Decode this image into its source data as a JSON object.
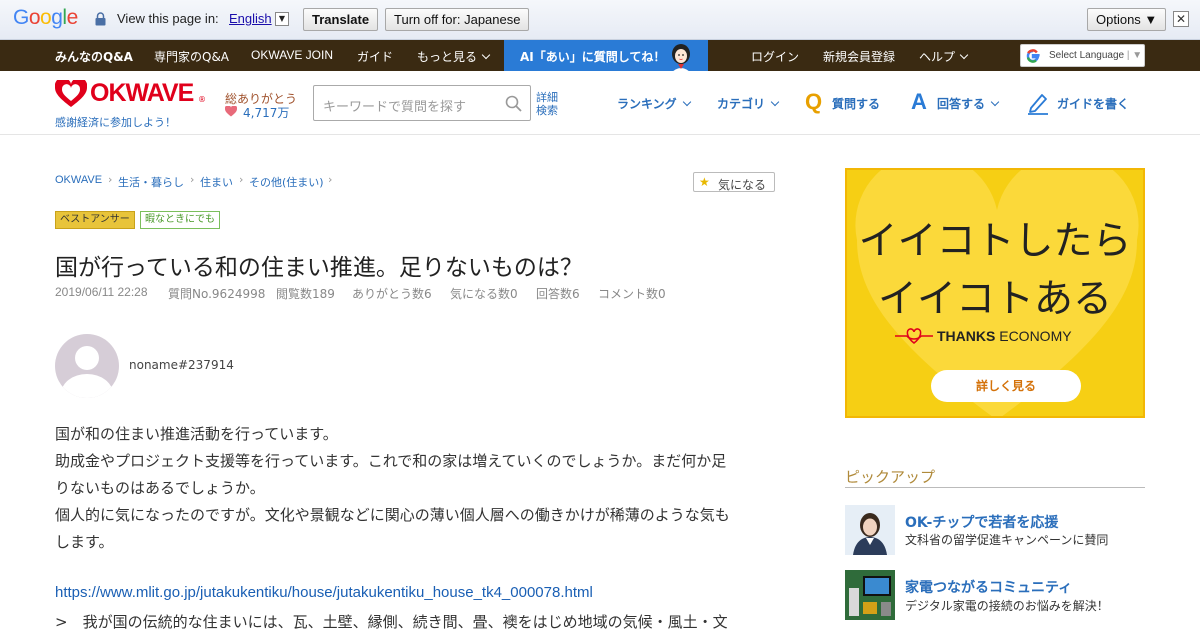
{
  "translate_bar": {
    "logo": "Google",
    "view_text": "View this page in:",
    "language": "English",
    "translate_label": "Translate",
    "turn_off_label": "Turn off for: Japanese",
    "options_label": "Options ▼",
    "close_glyph": "✕"
  },
  "top_nav": {
    "items": [
      "みんなのQ&A",
      "専門家のQ&A",
      "OKWAVE JOIN",
      "ガイド",
      "もっと見る"
    ],
    "ai_banner": "AI「あい」に質問してね！",
    "right_items": [
      "ログイン",
      "新規会員登録",
      "ヘルプ"
    ],
    "select_language": "Select Language"
  },
  "header": {
    "logo": "OKWAVE",
    "logo_mark": "®",
    "tagline": "感謝経済に参加しよう！",
    "thanks_label": "総ありがとう",
    "thanks_count": "4,717万",
    "search_placeholder": "キーワードで質問を探す",
    "advanced_search_line1": "詳細",
    "advanced_search_line2": "検索",
    "nav": [
      "ランキング",
      "カテゴリ",
      "質問する",
      "回答する",
      "ガイドを書く"
    ],
    "ask_glyph": "Q",
    "answer_glyph": "A"
  },
  "breadcrumb": [
    "OKWAVE",
    "生活・暮らし",
    "住まい",
    "その他(住まい)"
  ],
  "favorite_label": "気になる",
  "tags": [
    "ベストアンサー",
    "暇なときにでも"
  ],
  "question": {
    "title": "国が行っている和の住まい推進。足りないものは？",
    "meta": [
      "2019/06/11 22:28",
      "質問No.9624998",
      "閲覧数189",
      "ありがとう数6",
      "気になる数0",
      "回答数6",
      "コメント数0"
    ],
    "author": "noname#237914",
    "body": [
      "国が和の住まい推進活動を行っています。",
      "助成金やプロジェクト支援等を行っています。これで和の家は増えていくのでしょうか。まだ何か足",
      "りないものはあるでしょうか。",
      "個人的に気になったのですが。文化や景観などに関心の薄い個人層への働きかけが稀薄のような気も",
      "します。"
    ],
    "link": "https://www.mlit.go.jp/jutakukentiku/house/jutakukentiku_house_tk4_000078.html",
    "quote": ">　我が国の伝統的な住まいには、瓦、土壁、縁側、続き間、畳、襖をはじめ地域の気候・風土・文"
  },
  "ad": {
    "line1": "イイコトしたら",
    "line2": "イイコトある",
    "brand_bold": "THANKS",
    "brand_rest": " ECONOMY",
    "button": "詳しく見る"
  },
  "pickup": {
    "title": "ピックアップ",
    "items": [
      {
        "title": "OK-チップで若者を応援",
        "desc": "文科省の留学促進キャンペーンに賛同"
      },
      {
        "title": "家電つながるコミュニティ",
        "desc": "デジタル家電の接続のお悩みを解決！"
      }
    ]
  },
  "colors": {
    "brand_red": "#e0001b",
    "link_blue": "#2a6ebb",
    "nav_dark": "#3a2a12",
    "ai_blue": "#2a7bd6",
    "ad_yellow": "#f6cf14"
  }
}
